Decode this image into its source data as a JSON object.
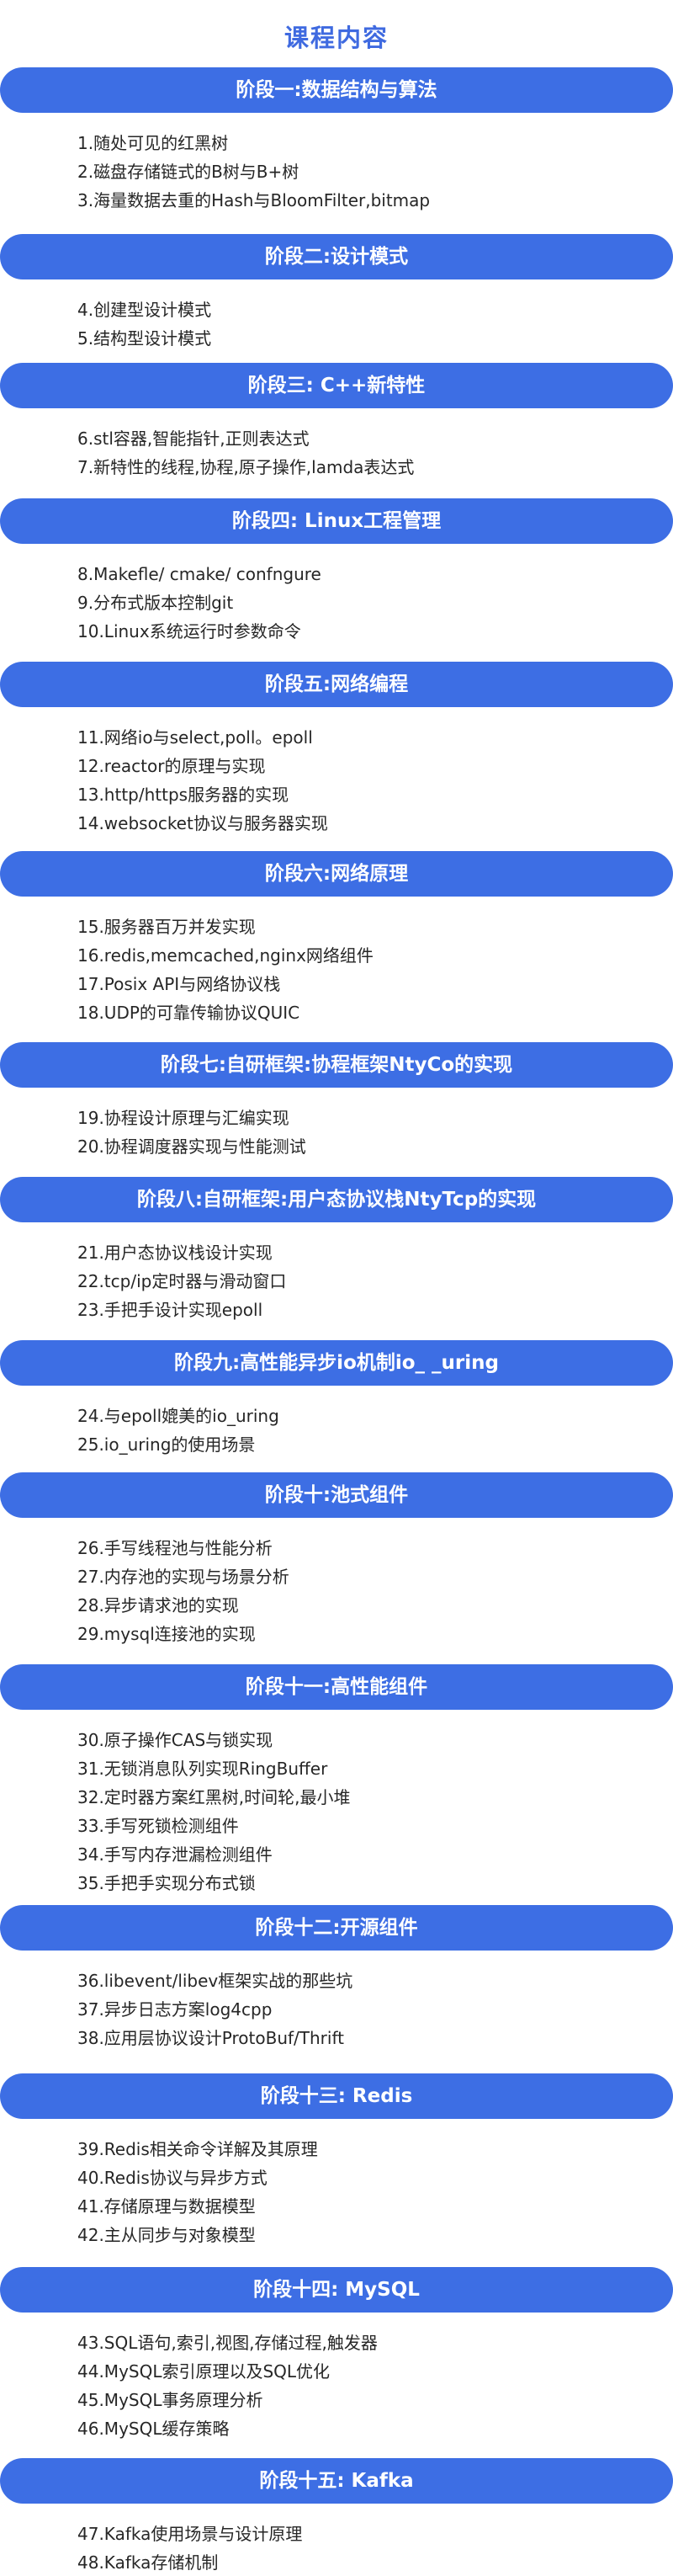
{
  "title": "课程内容",
  "stages": [
    {
      "title": "阶段一:数据结构与算法",
      "items": [
        "1.随处可见的红黑树",
        "2.磁盘存储链式的B树与B+树",
        "3.海量数据去重的Hash与BloomFilter,bitmap"
      ]
    },
    {
      "title": "阶段二:设计模式",
      "items": [
        "4.创建型设计模式",
        "5.结构型设计模式"
      ]
    },
    {
      "title": "阶段三: C++新特性",
      "items": [
        "6.stl容器,智能指针,正则表达式",
        "7.新特性的线程,协程,原子操作,lamda表达式"
      ]
    },
    {
      "title": "阶段四: Linux工程管理",
      "items": [
        "8.Makefle/ cmake/ confngure",
        "9.分布式版本控制git",
        "10.Linux系统运行时参数命令"
      ]
    },
    {
      "title": "阶段五:网络编程",
      "items": [
        "11.网络io与select,poll。epoll",
        "12.reactor的原理与实现",
        "13.http/https服务器的实现",
        "14.websocket协议与服务器实现"
      ]
    },
    {
      "title": "阶段六:网络原理",
      "items": [
        "15.服务器百万并发实现",
        "16.redis,memcached,nginx网络组件",
        "17.Posix API与网络协议栈",
        "18.UDP的可靠传输协议QUIC"
      ]
    },
    {
      "title": "阶段七:自研框架:协程框架NtyCo的实现",
      "items": [
        "19.协程设计原理与汇编实现",
        "20.协程调度器实现与性能测试"
      ]
    },
    {
      "title": "阶段八:自研框架:用户态协议栈NtyTcp的实现",
      "items": [
        "21.用户态协议栈设计实现",
        "22.tcp/ip定时器与滑动窗口",
        "23.手把手设计实现epoll"
      ]
    },
    {
      "title": "阶段九:高性能异步io机制io_ _uring",
      "items": [
        "24.与epoll媲美的io_uring",
        "25.io_uring的使用场景"
      ]
    },
    {
      "title": "阶段十:池式组件",
      "items": [
        "26.手写线程池与性能分析",
        "27.内存池的实现与场景分析",
        "28.异步请求池的实现",
        "29.mysql连接池的实现"
      ]
    },
    {
      "title": "阶段十一:高性能组件",
      "items": [
        "30.原子操作CAS与锁实现",
        "31.无锁消息队列实现RingBuffer",
        "32.定时器方案红黑树,时间轮,最小堆",
        "33.手写死锁检测组件",
        "34.手写内存泄漏检测组件",
        "35.手把手实现分布式锁"
      ]
    },
    {
      "title": "阶段十二:开源组件",
      "items": [
        "36.libevent/libev框架实战的那些坑",
        "37.异步日志方案log4cpp",
        "38.应用层协议设计ProtoBuf/Thrift"
      ]
    },
    {
      "title": "阶段十三: Redis",
      "items": [
        "39.Redis相关命令详解及其原理",
        "40.Redis协议与异步方式",
        "41.存储原理与数据模型",
        "42.主从同步与对象模型"
      ]
    },
    {
      "title": "阶段十四: MySQL",
      "items": [
        "43.SQL语句,索引,视图,存储过程,触发器",
        "44.MySQL索引原理以及SQL优化",
        "45.MySQL事务原理分析",
        "46.MySQL缓存策略"
      ]
    },
    {
      "title": "阶段十五: Kafka",
      "items": [
        "47.Kafka使用场景与设计原理",
        "48.Kafka存储机制"
      ]
    }
  ]
}
